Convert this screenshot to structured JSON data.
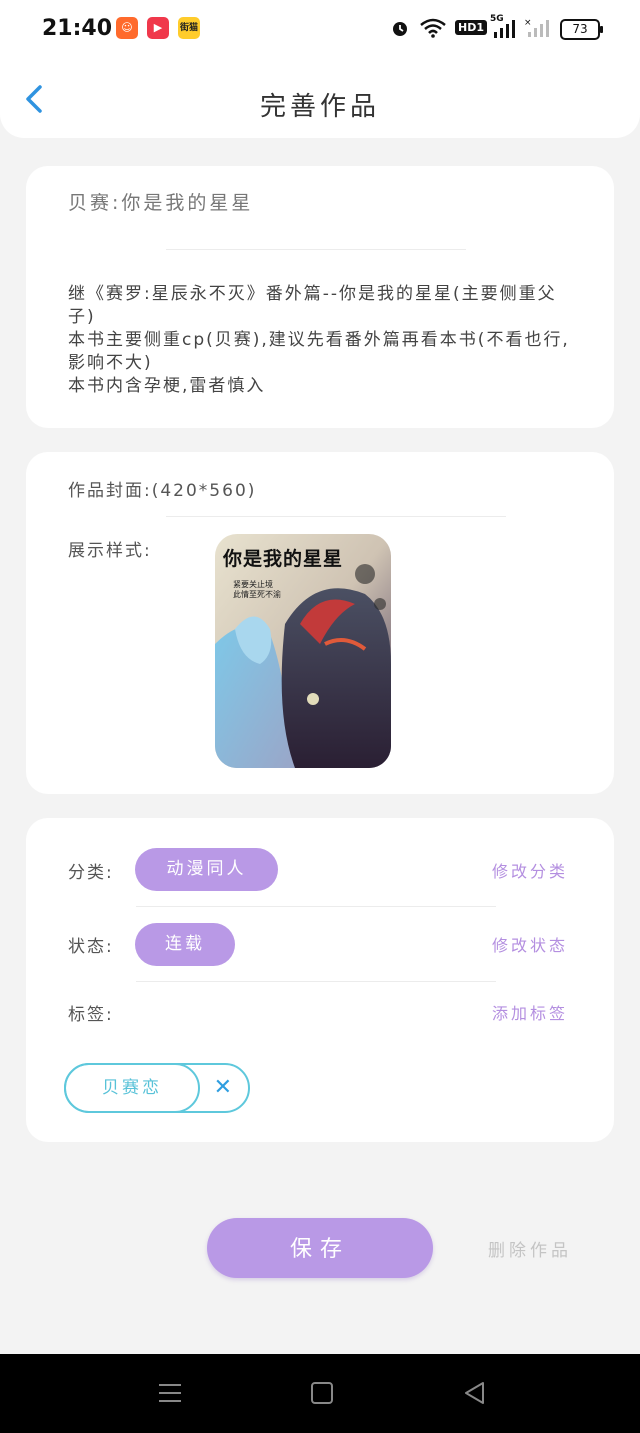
{
  "status": {
    "time": "21:40",
    "battery": "73",
    "app_icons": [
      "kuaishou-icon",
      "video-app-icon",
      "jiemao-app-icon"
    ],
    "app_icon_labels": [
      "",
      "▶",
      "街猫"
    ],
    "network": "HD1",
    "signal_5g": "5G"
  },
  "header": {
    "title": "完善作品",
    "back_icon": "chevron-left-icon"
  },
  "book": {
    "title": "贝赛:你是我的星星",
    "description": "继《赛罗:星辰永不灭》番外篇--你是我的星星(主要侧重父子)\n本书主要侧重cp(贝赛),建议先看番外篇再看本书(不看也行,影响不大)\n本书内含孕梗,雷者慎入"
  },
  "cover": {
    "label": "作品封面:(420*560)",
    "style_label": "展示样式:",
    "image_title": "你是我的星星",
    "image_subtitle_1": "紧要关止境",
    "image_subtitle_2": "此情至死不渝"
  },
  "meta": {
    "category_label": "分类:",
    "category_value": "动漫同人",
    "category_action": "修改分类",
    "status_label": "状态:",
    "status_value": "连载",
    "status_action": "修改状态",
    "tags_label": "标签:",
    "tags_action": "添加标签",
    "tags": [
      {
        "label": "贝赛恋",
        "remove_icon": "close-icon"
      }
    ]
  },
  "actions": {
    "save": "保存",
    "delete": "删除作品"
  },
  "colors": {
    "accent_purple": "#b999e6",
    "tag_cyan": "#5ec8dc",
    "back_blue": "#2f93e0"
  },
  "navbar": {
    "icons": [
      "menu-icon",
      "home-square-icon",
      "back-triangle-icon"
    ]
  }
}
